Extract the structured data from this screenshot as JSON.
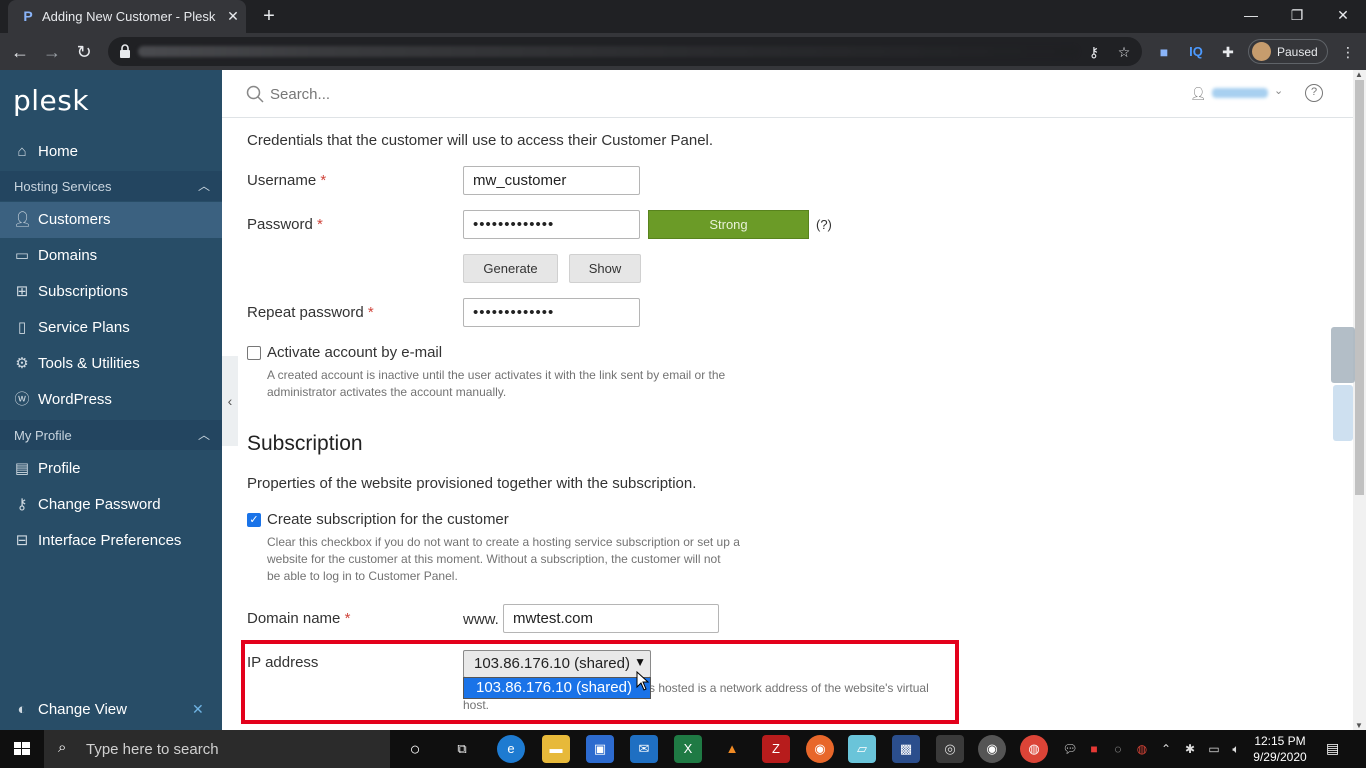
{
  "browser": {
    "tab_title": "Adding New Customer - Plesk Ob",
    "new_tab": "+",
    "paused_label": "Paused",
    "toolbar_icons": [
      "key-icon",
      "star-icon",
      "extension-camera-icon",
      "iq-icon",
      "puzzle-icon",
      "menu-dots-icon"
    ]
  },
  "sidebar": {
    "logo": "plesk",
    "items_top": [
      {
        "label": "Home",
        "icon": "home-icon"
      }
    ],
    "group_hosting": "Hosting Services",
    "hosting_items": [
      {
        "label": "Customers",
        "icon": "user-icon",
        "active": true
      },
      {
        "label": "Domains",
        "icon": "monitor-icon"
      },
      {
        "label": "Subscriptions",
        "icon": "grid-icon"
      },
      {
        "label": "Service Plans",
        "icon": "book-icon"
      },
      {
        "label": "Tools & Utilities",
        "icon": "tools-icon"
      },
      {
        "label": "WordPress",
        "icon": "wordpress-icon"
      }
    ],
    "group_profile": "My Profile",
    "profile_items": [
      {
        "label": "Profile",
        "icon": "briefcase-icon"
      },
      {
        "label": "Change Password",
        "icon": "key-icon"
      },
      {
        "label": "Interface Preferences",
        "icon": "layout-icon"
      }
    ],
    "change_view": "Change View"
  },
  "header": {
    "search_placeholder": "Search..."
  },
  "form": {
    "credentials_intro": "Credentials that the customer will use to access their Customer Panel.",
    "username_label": "Username",
    "username_value": "mw_customer",
    "password_label": "Password",
    "password_value": "•••••••••••••",
    "strength": "Strong",
    "strength_help": "(?)",
    "generate": "Generate",
    "show": "Show",
    "repeat_label": "Repeat password",
    "repeat_value": "•••••••••••••",
    "activate_label": "Activate account by e-mail",
    "activate_hint_1": "A created account is inactive until the user activates it with the link sent by email or the",
    "activate_hint_2": "administrator activates the account manually.",
    "subscription_heading": "Subscription",
    "subscription_intro": "Properties of the website provisioned together with the subscription.",
    "create_sub_label": "Create subscription for the customer",
    "create_sub_hint_1": "Clear this checkbox if you do not want to create a hosting service subscription or set up a",
    "create_sub_hint_2": "website for the customer at this moment. Without a subscription, the customer will not",
    "create_sub_hint_3": "be able to log in to Customer Panel.",
    "domain_label": "Domain name",
    "www_prefix": "www.",
    "domain_value": "mwtest.com",
    "ip_label": "IP address",
    "ip_selected": "103.86.176.10 (shared)",
    "ip_option": "103.86.176.10 (shared)",
    "ip_hint_1": "s hosted is a network address of the website's virtual",
    "ip_hint_2": "host.",
    "required_mark": "*"
  },
  "taskbar": {
    "search_text": "Type here to search",
    "time": "12:15 PM",
    "date": "9/29/2020"
  },
  "colors": {
    "sidebar_bg": "#284d67",
    "active_item": "#3b6180",
    "strength_green": "#6b9b27",
    "highlight_red": "#e3001b",
    "select_blue": "#1a73e8"
  }
}
